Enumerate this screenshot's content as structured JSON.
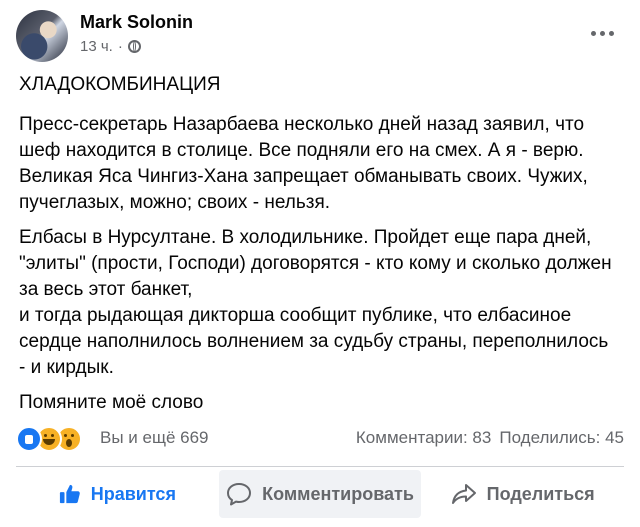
{
  "post": {
    "author": "Mark Solonin",
    "time": "13 ч.",
    "separator": "·",
    "privacy_icon": "globe-icon",
    "paragraphs": [
      "ХЛАДОКОМБИНАЦИЯ",
      "Пресс-секретарь Назарбаева несколько дней назад заявил, что шеф находится в столице. Все подняли его на смех. А я - верю. Великая Яса Чингиз-Хана запрещает обманывать своих. Чужих, пучеглазых, можно; своих - нельзя.",
      "Елбасы в Нурсултане. В холодильнике. Пройдет еще пара дней, \"элиты\" (прости, Господи) договорятся - кто кому и сколько должен за весь этот банкет,\nи тогда рыдающая дикторша сообщит публике, что елбасиное сердце наполнилось волнением за судьбу страны, переполнилось - и кирдык.",
      "Помяните моё слово"
    ]
  },
  "reactions": {
    "icons": [
      "like-icon",
      "haha-icon",
      "wow-icon"
    ],
    "count_text": "Вы и ещё 669",
    "comments_text": "Комментарии: 83",
    "shares_text": "Поделились: 45"
  },
  "actions": {
    "like": "Нравится",
    "comment": "Комментировать",
    "share": "Поделиться"
  },
  "colors": {
    "accent": "#1877f2",
    "secondary_text": "#65676b",
    "divider": "#ced0d4",
    "reaction_yellow": "#f7b125"
  }
}
